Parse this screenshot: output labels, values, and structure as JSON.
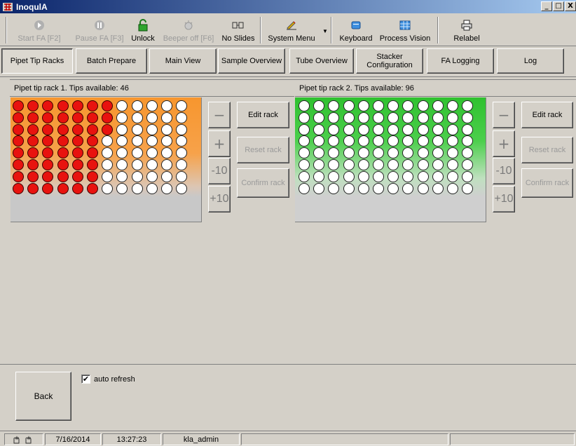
{
  "window": {
    "title": "InoqulA",
    "controls": [
      "_",
      "□",
      "X"
    ]
  },
  "toolbar": {
    "items": [
      {
        "label": "Start FA [F2]",
        "icon": "play-icon",
        "enabled": false
      },
      {
        "label": "Pause FA [F3]",
        "icon": "pause-icon",
        "enabled": false
      },
      {
        "label": "Unlock",
        "icon": "unlock-icon",
        "enabled": true
      },
      {
        "label": "Beeper off [F6]",
        "icon": "beeper-icon",
        "enabled": false
      },
      {
        "label": "No Slides",
        "icon": "slides-icon",
        "enabled": true
      },
      {
        "label": "System Menu",
        "icon": "system-menu-icon",
        "enabled": true
      },
      {
        "label": "Keyboard",
        "icon": "keyboard-icon",
        "enabled": true
      },
      {
        "label": "Process Vision",
        "icon": "process-vision-icon",
        "enabled": true
      },
      {
        "label": "Relabel",
        "icon": "printer-icon",
        "enabled": true
      }
    ]
  },
  "tabs": [
    {
      "label": "Pipet Tip Racks",
      "active": true
    },
    {
      "label": "Batch Prepare"
    },
    {
      "label": "Main View"
    },
    {
      "label": "Sample Overview"
    },
    {
      "label": "Tube Overview"
    },
    {
      "label": "Stacker Configuration"
    },
    {
      "label": "FA Logging"
    },
    {
      "label": "Log"
    }
  ],
  "racks": [
    {
      "header": "Pipet tip rack 1. Tips available: 46",
      "rows": 8,
      "cols": 12,
      "used_per_row": [
        7,
        7,
        7,
        6,
        6,
        6,
        6,
        6
      ],
      "accent": "#f7962e"
    },
    {
      "header": "Pipet tip rack 2. Tips available: 96",
      "rows": 8,
      "cols": 12,
      "used_per_row": [
        0,
        0,
        0,
        0,
        0,
        0,
        0,
        0
      ],
      "accent": "#2fc12f"
    }
  ],
  "rack_controls": {
    "minus": "−",
    "plus": "+",
    "minus10": "-10",
    "plus10": "+10",
    "edit": "Edit rack",
    "reset": "Reset rack",
    "confirm": "Confirm rack"
  },
  "bottom": {
    "back": "Back",
    "auto_refresh_label": "auto refresh",
    "auto_refresh_checked": true,
    "check_mark": "✔"
  },
  "status": {
    "date": "7/16/2014",
    "time": "13:27:23",
    "user": "kla_admin"
  },
  "colors": {
    "used_tip": "#e8130f",
    "free_tip": "#ffffff",
    "face": "#d4d0c8"
  }
}
